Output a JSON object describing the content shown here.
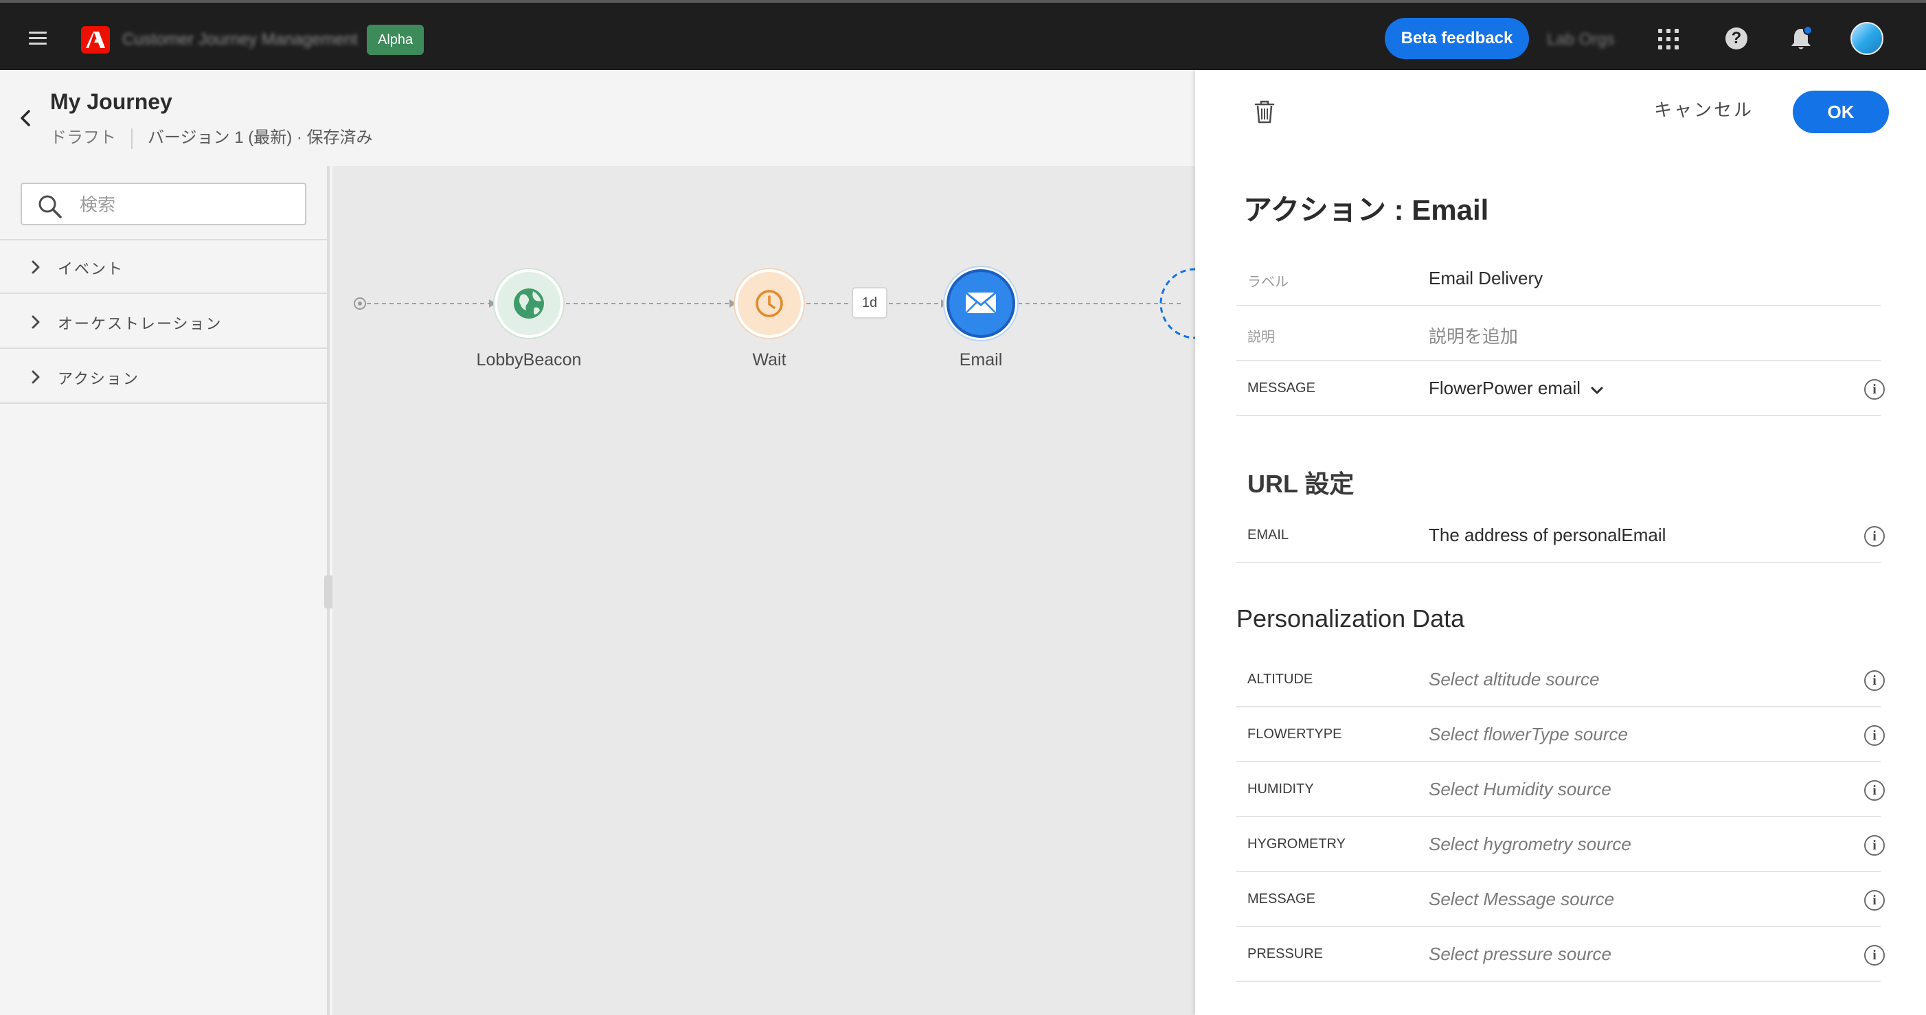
{
  "topbar": {
    "product_name": "Customer Journey Management",
    "alpha_badge": "Alpha",
    "beta_feedback": "Beta feedback",
    "org_name": "Lab Orgs",
    "accent_color": "#1473e6"
  },
  "journey": {
    "title": "My Journey",
    "status": "ドラフト",
    "version": "バージョン 1 (最新) · 保存済み"
  },
  "palette": {
    "search_placeholder": "検索",
    "items": [
      {
        "label": "イベント",
        "icon": "chevron-right-icon"
      },
      {
        "label": "オーケストレーション",
        "icon": "chevron-right-icon"
      },
      {
        "label": "アクション",
        "icon": "chevron-right-icon"
      }
    ]
  },
  "canvas": {
    "nodes": [
      {
        "label": "LobbyBeacon",
        "icon": "globe-icon",
        "color": "#3f9b6a"
      },
      {
        "label": "Wait",
        "icon": "clock-icon",
        "color": "#e08a2a"
      },
      {
        "label": "Email",
        "icon": "envelope-icon",
        "color": "#1473e6"
      }
    ],
    "wait_duration": "1d"
  },
  "panel": {
    "cancel": "キャンセル",
    "ok": "OK",
    "title": "アクション : Email",
    "fields": [
      {
        "label": "ラベル",
        "value": "Email Delivery"
      },
      {
        "label": "説明",
        "value": "説明を追加"
      },
      {
        "label": "MESSAGE",
        "value": "FlowerPower email"
      }
    ],
    "url_section": "URL 設定",
    "url_fields": [
      {
        "label": "EMAIL",
        "value": "The address of personalEmail"
      }
    ],
    "personalization_section": "Personalization Data",
    "personalization_fields": [
      {
        "label": "ALTITUDE",
        "value": "Select altitude source"
      },
      {
        "label": "FLOWERTYPE",
        "value": "Select flowerType source"
      },
      {
        "label": "HUMIDITY",
        "value": "Select Humidity source"
      },
      {
        "label": "HYGROMETRY",
        "value": "Select hygrometry source"
      },
      {
        "label": "MESSAGE",
        "value": "Select Message source"
      },
      {
        "label": "PRESSURE",
        "value": "Select pressure source"
      }
    ]
  }
}
